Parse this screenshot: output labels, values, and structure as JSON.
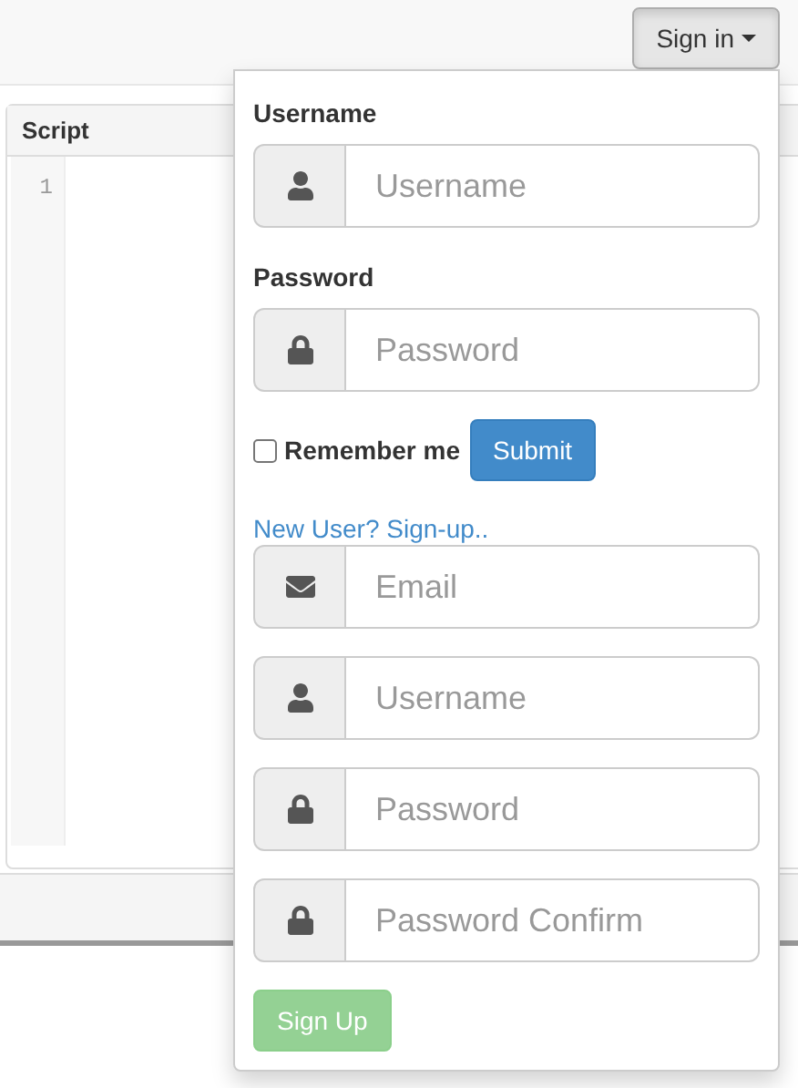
{
  "navbar": {
    "signin_button": {
      "label": "Sign in",
      "expanded": true
    }
  },
  "editor": {
    "title": "Script",
    "line_numbers": [
      "1"
    ]
  },
  "login": {
    "username_label": "Username",
    "username_placeholder": "Username",
    "password_label": "Password",
    "password_placeholder": "Password",
    "remember": {
      "label": "Remember me",
      "checked": false
    },
    "submit": "Submit"
  },
  "signup": {
    "link": "New User? Sign-up..",
    "fields": [
      {
        "kind": "email",
        "placeholder": "Email"
      },
      {
        "kind": "username",
        "placeholder": "Username"
      },
      {
        "kind": "password",
        "placeholder": "Password"
      },
      {
        "kind": "password",
        "placeholder": "Password Confirm"
      }
    ],
    "button": {
      "label": "Sign Up",
      "disabled": true
    }
  }
}
